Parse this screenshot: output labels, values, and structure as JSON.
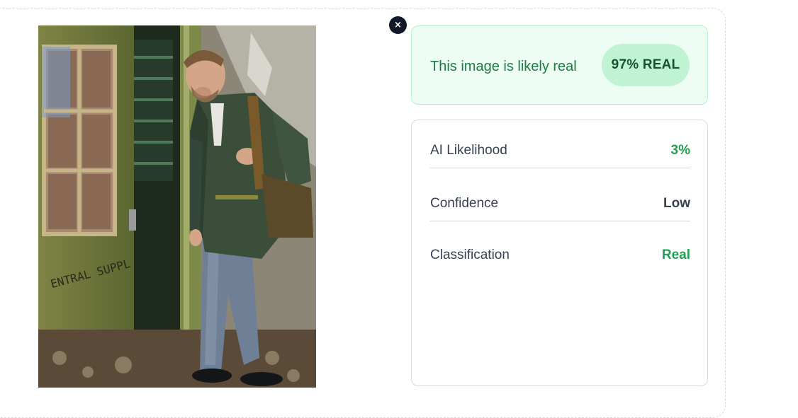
{
  "verdict": {
    "text": "This image is likely real",
    "badge": "97% REAL"
  },
  "close": {
    "label": "×",
    "icon": "close-icon"
  },
  "details": {
    "rows": [
      {
        "label": "AI Likelihood",
        "value": "3%",
        "color": "#22a052"
      },
      {
        "label": "Confidence",
        "value": "Low",
        "color": "#374151"
      },
      {
        "label": "Classification",
        "value": "Real",
        "color": "#22a052"
      }
    ]
  },
  "colors": {
    "success_bg": "#edfdf3",
    "success_border": "#b9efcc",
    "success_text": "#1f7a45",
    "badge_bg": "#bff3d2",
    "close_bg": "#111827"
  }
}
